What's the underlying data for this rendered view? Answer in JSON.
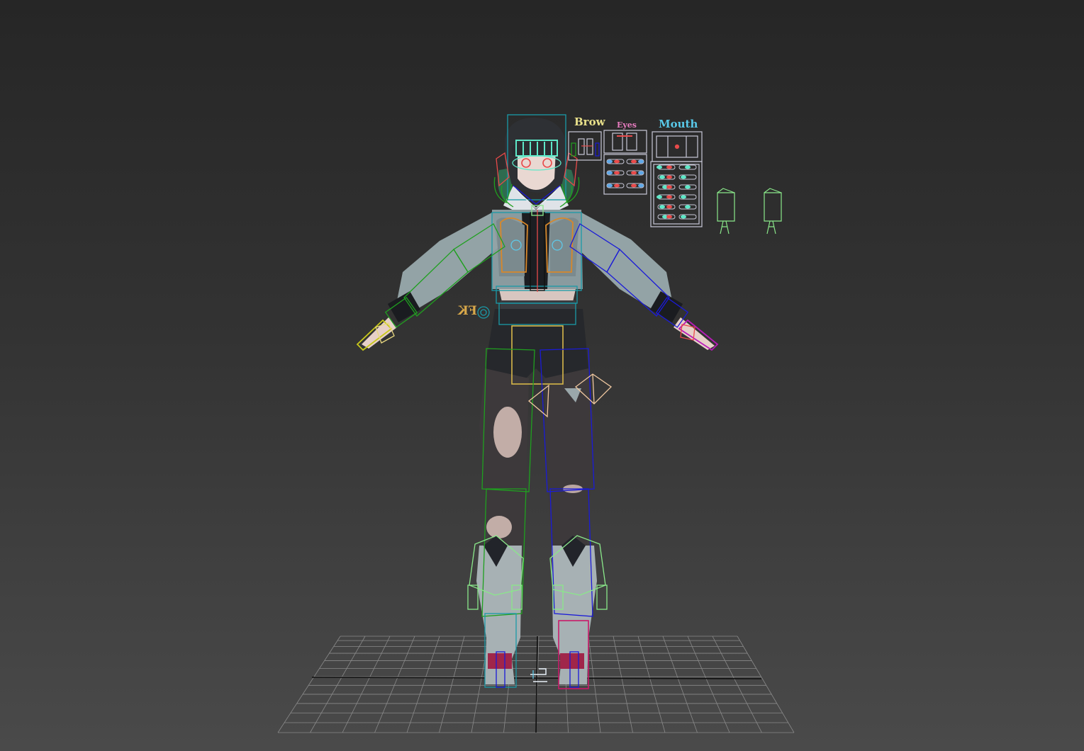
{
  "viewport": {
    "background_top": "#262626",
    "background_bottom": "#4a4a4a",
    "grid_color": "#8a8a8a",
    "axis_color": "#101010"
  },
  "face_controls": {
    "brow_label": "Brow",
    "eyes_label": "Eyes",
    "mouth_label": "Mouth",
    "brow_color": "#e8e08a",
    "eyes_color": "#e87cc0",
    "mouth_color": "#58c8e8"
  },
  "ik_fk": {
    "label": "FK",
    "color": "#d8a84a"
  },
  "rig_colors": {
    "left_side": "#1fa01f",
    "right_side": "#1a1ad8",
    "center": "#1a9aa8",
    "chest": "#d8882a",
    "pelvis": "#d8b84a",
    "hand_left": "#c8c81a",
    "hand_right": "#b81ab8",
    "foot_right": "#c81a6a",
    "boot": "#8ae88a"
  }
}
